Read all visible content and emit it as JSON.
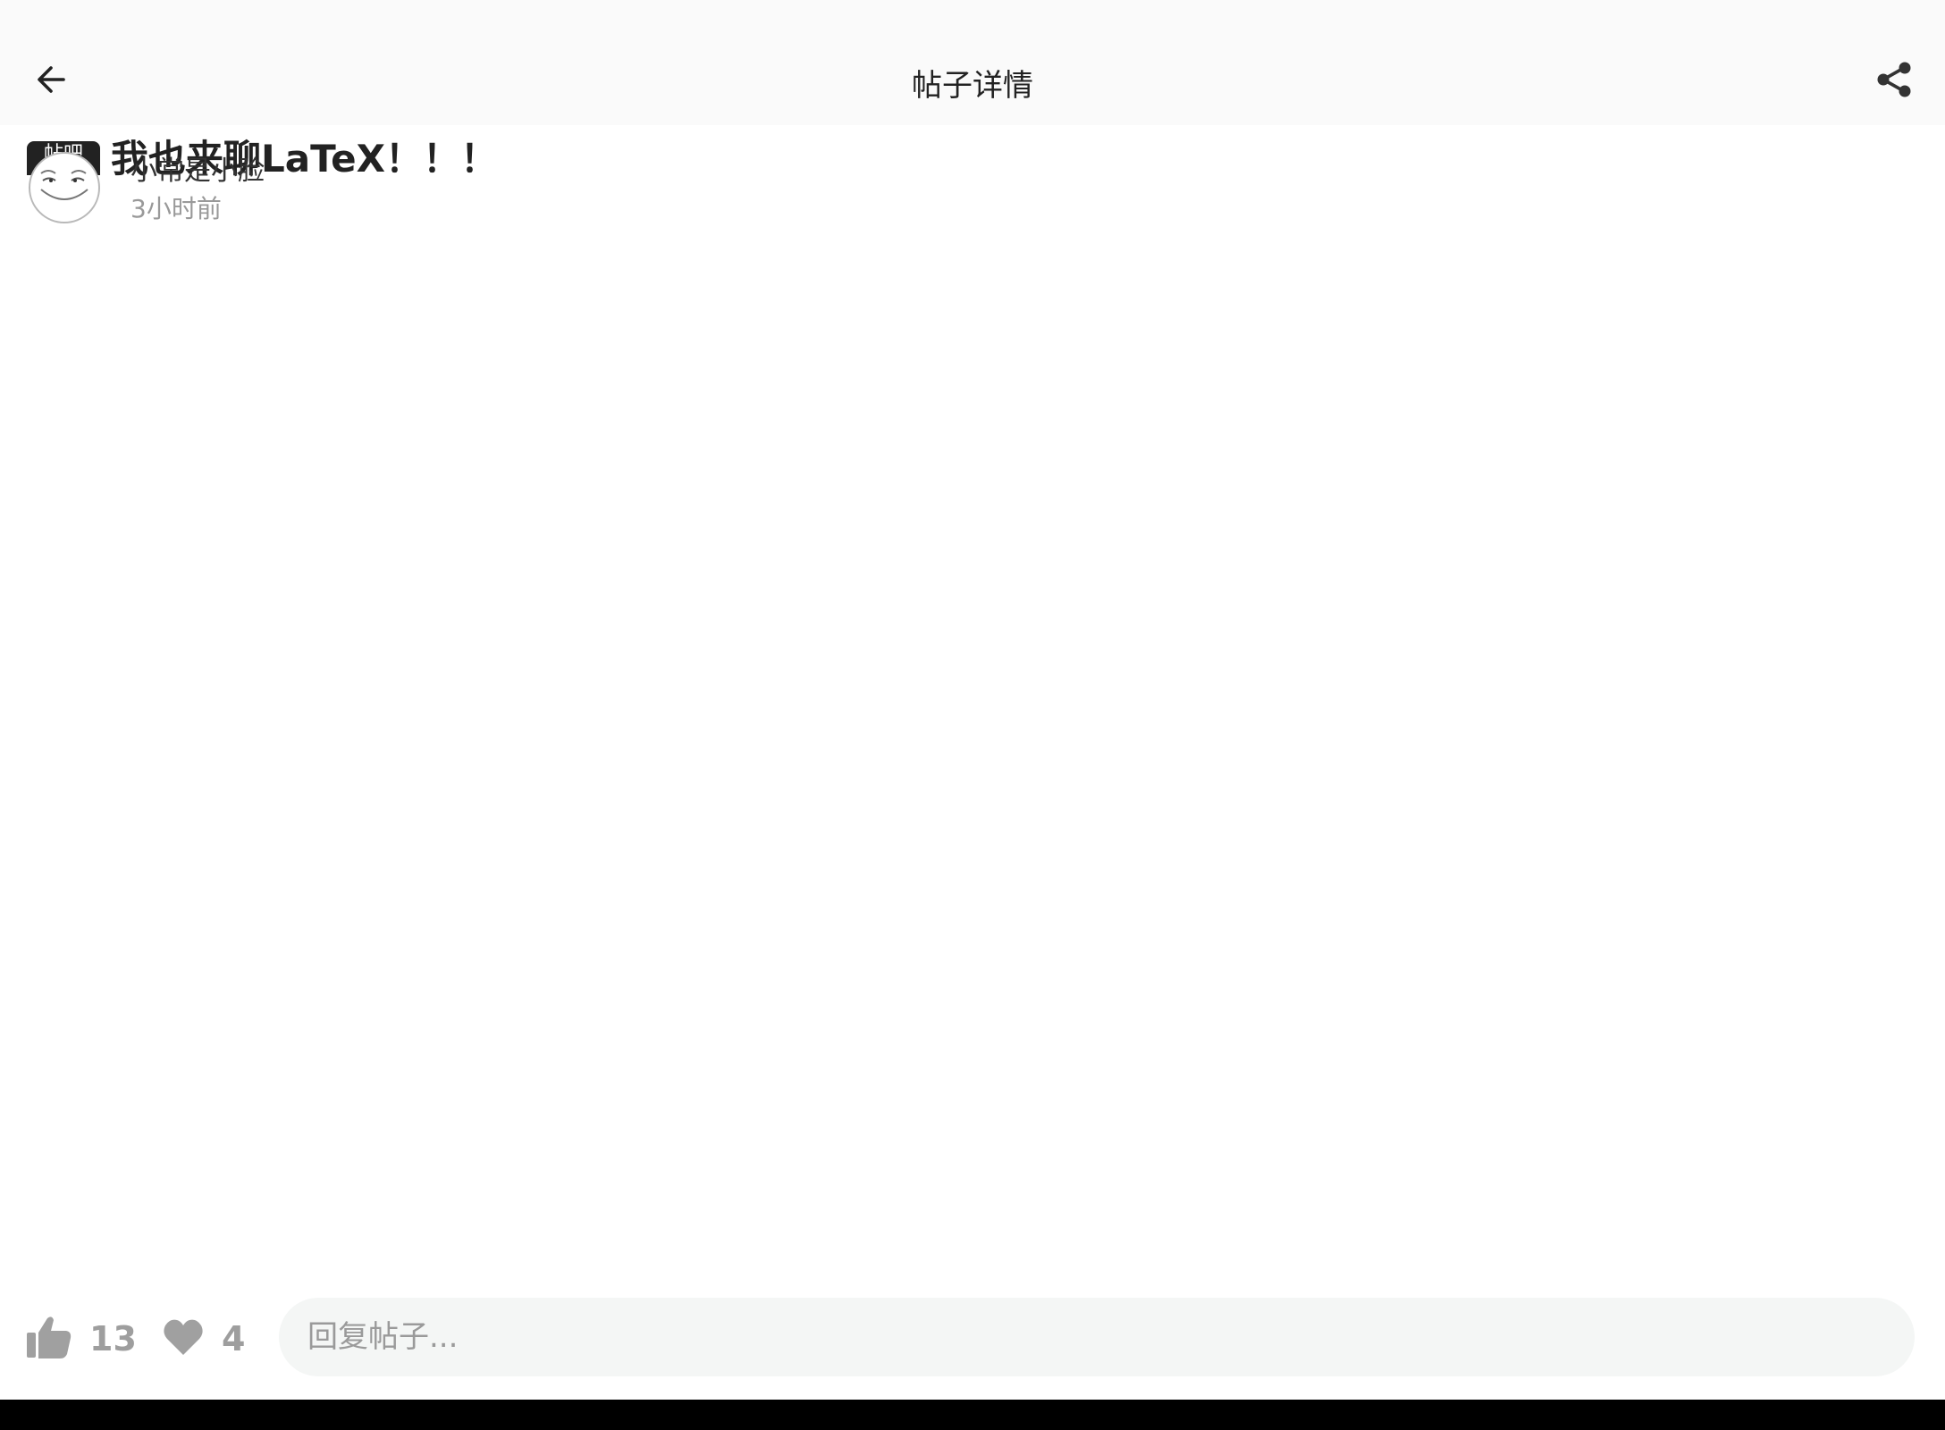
{
  "header": {
    "title": "帖子详情",
    "back_icon": "arrow-back-icon",
    "share_icon": "share-icon"
  },
  "post": {
    "tag": "帖吧",
    "title": "我也来聊LaTeX！！！",
    "author": "小常是小脸",
    "time": "3小时前"
  },
  "actions": {
    "like_count": "13",
    "favorite_count": "4",
    "like_icon": "thumb-up-icon",
    "favorite_icon": "heart-icon"
  },
  "reply": {
    "placeholder": "回复帖子..."
  },
  "colors": {
    "text_primary": "#222222",
    "text_secondary": "#999999",
    "icon_gray": "#9e9e9e",
    "input_bg": "#f4f6f5",
    "system_bar": "#000000"
  }
}
